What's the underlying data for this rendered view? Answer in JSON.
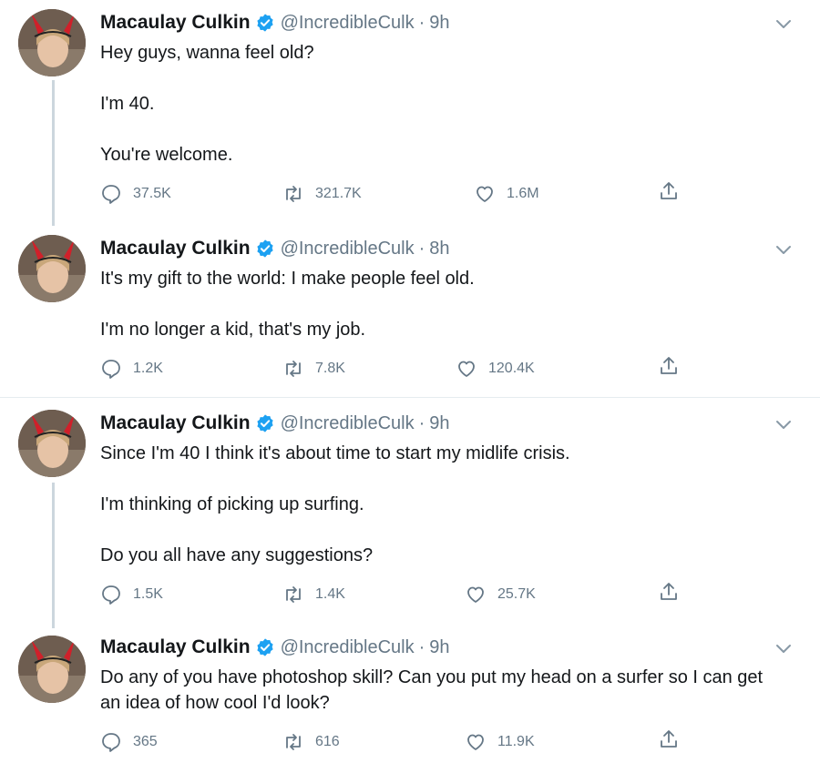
{
  "accent_color": "#1da1f2",
  "tweets": [
    {
      "name": "Macaulay Culkin",
      "handle": "@IncredibleCulk",
      "time": "9h",
      "lines": [
        "Hey guys, wanna feel old?",
        "I'm 40.",
        "You're welcome."
      ],
      "reply": "37.5K",
      "retweet": "321.7K",
      "like": "1.6M"
    },
    {
      "name": "Macaulay Culkin",
      "handle": "@IncredibleCulk",
      "time": "8h",
      "lines": [
        "It's my gift to the world: I make people feel old.",
        "I'm no longer a kid, that's my job."
      ],
      "reply": "1.2K",
      "retweet": "7.8K",
      "like": "120.4K"
    },
    {
      "name": "Macaulay Culkin",
      "handle": "@IncredibleCulk",
      "time": "9h",
      "lines": [
        "Since I'm 40 I think it's about time to start my midlife crisis.",
        "I'm thinking of picking up surfing.",
        "Do you all have any suggestions?"
      ],
      "reply": "1.5K",
      "retweet": "1.4K",
      "like": "25.7K"
    },
    {
      "name": "Macaulay Culkin",
      "handle": "@IncredibleCulk",
      "time": "9h",
      "lines": [
        "Do any of you have photoshop skill? Can you put my head on a surfer so I can get an idea of how cool I'd look?"
      ],
      "reply": "365",
      "retweet": "616",
      "like": "11.9K"
    }
  ]
}
